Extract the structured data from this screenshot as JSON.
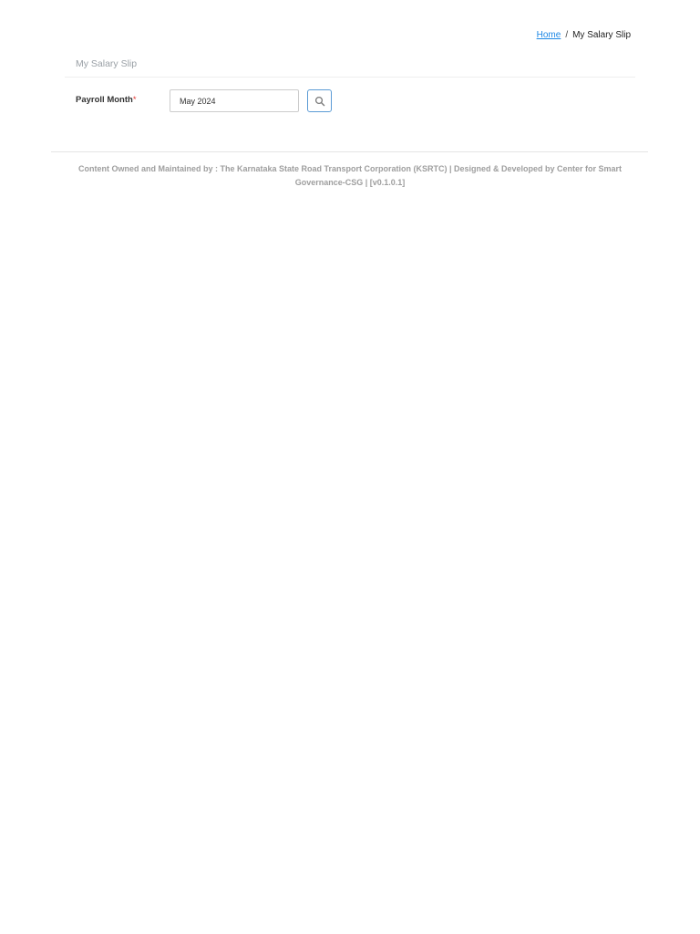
{
  "breadcrumb": {
    "home_label": "Home",
    "separator": "/",
    "current_label": "My Salary Slip"
  },
  "card": {
    "title": "My Salary Slip"
  },
  "form": {
    "payroll_month_label": "Payroll Month",
    "required_marker": "*",
    "payroll_month_value": "May 2024"
  },
  "icons": {
    "search_button_icon": "search-icon"
  },
  "colors": {
    "link": "#1e88e5",
    "required": "#e53935",
    "button_border": "#5b9bd5",
    "muted_text": "#9e9e9e"
  },
  "footer": {
    "text": "Content Owned and Maintained by : The Karnataka State Road Transport Corporation (KSRTC) | Designed & Developed by Center for Smart Governance-CSG | [v0.1.0.1]"
  }
}
